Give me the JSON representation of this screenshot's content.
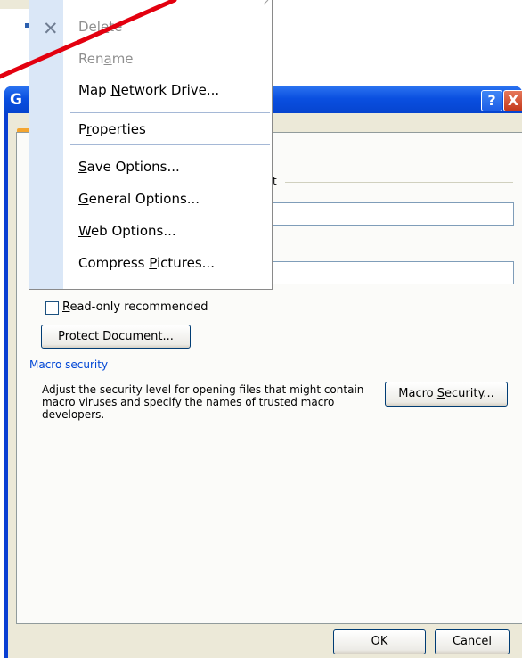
{
  "dialog": {
    "title": "G",
    "help_glyph": "?",
    "close_glyph": "X",
    "fragment_label": "t",
    "read_only": {
      "label_prefix": "",
      "mnemonic": "R",
      "label_rest": "ead-only recommended",
      "checked": false
    },
    "protect_button": {
      "mnemonic": "P",
      "rest": "rotect Document..."
    },
    "macro_group_label": "Macro security",
    "macro_description": "Adjust the security level for opening files that might contain macro viruses and specify the names of trusted macro developers.",
    "macro_button": {
      "prefix": "Macro ",
      "mnemonic": "S",
      "rest": "ecurity..."
    },
    "ok_label": "OK",
    "cancel_label": "Cancel"
  },
  "menu": {
    "items": [
      {
        "pre": "Del",
        "mn": "e",
        "post": "te",
        "disabled": true,
        "icon": "delete-x-icon"
      },
      {
        "pre": "Ren",
        "mn": "a",
        "post": "me",
        "disabled": true
      },
      {
        "pre": "Map ",
        "mn": "N",
        "post": "etwork Drive...",
        "disabled": false
      },
      {
        "pre": "P",
        "mn": "r",
        "post": "operties",
        "disabled": false
      },
      {
        "pre": "",
        "mn": "S",
        "post": "ave Options...",
        "disabled": false
      },
      {
        "pre": "",
        "mn": "G",
        "post": "eneral Options...",
        "disabled": false
      },
      {
        "pre": "",
        "mn": "W",
        "post": "eb Options...",
        "disabled": false
      },
      {
        "pre": "Compress ",
        "mn": "P",
        "post": "ictures...",
        "disabled": false
      }
    ]
  },
  "colors": {
    "title_bar": "#0a4fe0",
    "dialog_face": "#ece9d8",
    "group_label": "#0046d5",
    "menu_strip": "#dae7f7",
    "arrow": "#e3000f"
  }
}
